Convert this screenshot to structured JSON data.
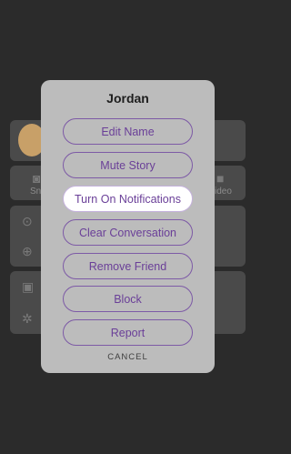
{
  "background": {
    "snap_label": "Sna",
    "video_label": "ideo"
  },
  "dialog": {
    "title": "Jordan",
    "options": [
      "Edit Name",
      "Mute Story",
      "Turn On Notifications",
      "Clear Conversation",
      "Remove Friend",
      "Block",
      "Report"
    ],
    "cancel": "CANCEL"
  },
  "colors": {
    "accent": "#6a3f98",
    "dialog_bg": "#bcbcbc"
  }
}
